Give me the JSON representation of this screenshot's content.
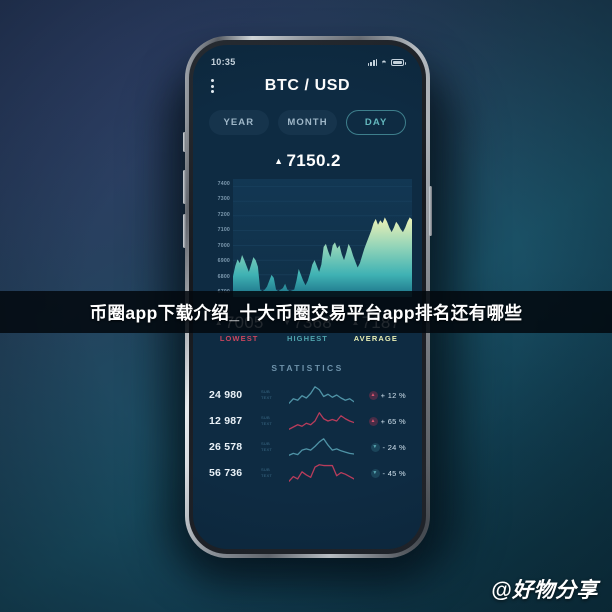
{
  "status_bar": {
    "time": "10:35",
    "signal_icon": "signal-bars-icon",
    "wifi_icon": "wifi-icon",
    "battery_icon": "battery-icon"
  },
  "header": {
    "menu_icon": "kebab-menu-icon",
    "title": "BTC / USD"
  },
  "period_tabs": [
    {
      "label": "YEAR",
      "active": false
    },
    {
      "label": "MONTH",
      "active": false
    },
    {
      "label": "DAY",
      "active": true
    }
  ],
  "price": {
    "caret": "▲",
    "value": "7150.2"
  },
  "summary": [
    {
      "caret": "▲",
      "value": "7005",
      "label": "LOWEST",
      "color": "#c9455e"
    },
    {
      "caret": "▼",
      "value": "7368",
      "label": "HIGHEST",
      "color": "#4fa3ad"
    },
    {
      "caret": "▲",
      "value": "7187",
      "label": "AVERAGE",
      "color": "#e8eeb4"
    }
  ],
  "statistics": {
    "section_title": "STATISTICS",
    "rows": [
      {
        "value": "24 980",
        "sub1": "SUB",
        "sub2": "TEXT",
        "change": "+ 12 %",
        "direction": "up",
        "line_color": "#4f93a6"
      },
      {
        "value": "12 987",
        "sub1": "SUB",
        "sub2": "TEXT",
        "change": "+ 65 %",
        "direction": "up",
        "line_color": "#b83c5b"
      },
      {
        "value": "26 578",
        "sub1": "SUB",
        "sub2": "TEXT",
        "change": "- 24 %",
        "direction": "down",
        "line_color": "#4f93a6"
      },
      {
        "value": "56 736",
        "sub1": "SUB",
        "sub2": "TEXT",
        "change": "- 45 %",
        "direction": "down",
        "line_color": "#b83c5b"
      }
    ]
  },
  "overlay": {
    "caption": "币圈app下载介绍_十大币圈交易平台app排名还有哪些",
    "watermark": "@好物分享"
  },
  "chart_data": {
    "type": "area",
    "title": "BTC / USD price (DAY)",
    "xlabel": "",
    "ylabel": "",
    "ylim": [
      6650,
      7450
    ],
    "grid": true,
    "yticks": [
      7400,
      7300,
      7200,
      7100,
      7000,
      6900,
      6800,
      6700
    ],
    "ytick_labels": [
      "7400",
      "7300",
      "7200",
      "7100",
      "7000",
      "6900",
      "6800",
      "6700"
    ],
    "fill_gradient": [
      "#e8edb0",
      "#3fb6b0",
      "#1d7f91"
    ],
    "values": [
      6790,
      6860,
      6905,
      6880,
      6935,
      6900,
      6860,
      6820,
      6870,
      6920,
      6900,
      6855,
      6700,
      6690,
      6700,
      6720,
      6760,
      6800,
      6780,
      6700,
      6690,
      6700,
      6710,
      6740,
      6700,
      6690,
      6695,
      6700,
      6760,
      6840,
      6800,
      6760,
      6730,
      6760,
      6810,
      6870,
      6900,
      6860,
      6820,
      6870,
      6990,
      7010,
      6960,
      6920,
      7000,
      7020,
      6980,
      7000,
      6940,
      6900,
      6950,
      7010,
      6980,
      6930,
      6890,
      6850,
      6880,
      6930,
      6980,
      7020,
      7060,
      7100,
      7150,
      7180,
      7140,
      7170,
      7150,
      7190,
      7160,
      7120,
      7090,
      7120,
      7160,
      7140,
      7110,
      7090,
      7120,
      7160,
      7190,
      7175
    ],
    "sparklines": [
      {
        "name": "24 980",
        "color": "#4f93a6",
        "values": [
          30,
          42,
          38,
          50,
          44,
          56,
          74,
          66,
          48,
          54,
          46,
          52,
          44,
          38,
          42,
          34
        ]
      },
      {
        "name": "12 987",
        "color": "#b83c5b",
        "values": [
          22,
          28,
          34,
          30,
          38,
          34,
          44,
          66,
          50,
          44,
          48,
          44,
          58,
          50,
          44,
          40
        ]
      },
      {
        "name": "26 578",
        "color": "#4f93a6",
        "values": [
          28,
          34,
          30,
          44,
          48,
          44,
          56,
          70,
          80,
          60,
          44,
          48,
          42,
          38,
          34,
          32
        ]
      },
      {
        "name": "56 736",
        "color": "#b83c5b",
        "values": [
          24,
          36,
          30,
          48,
          40,
          34,
          60,
          66,
          64,
          64,
          64,
          38,
          46,
          42,
          36,
          30
        ]
      }
    ]
  }
}
